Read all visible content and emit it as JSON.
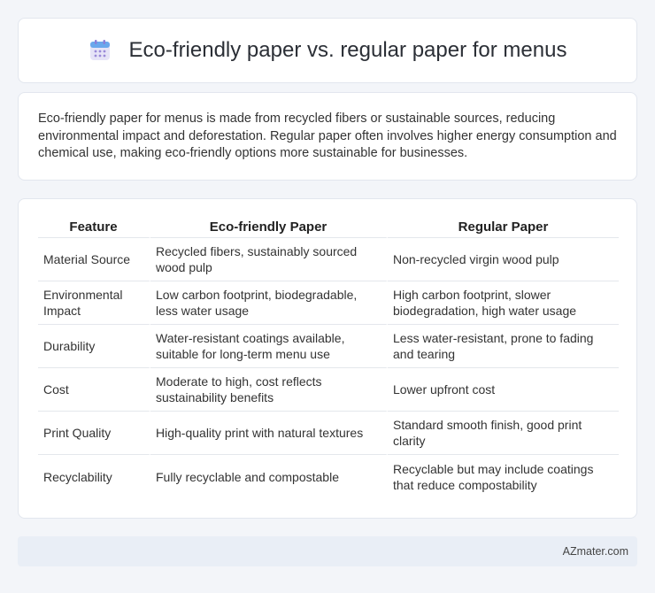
{
  "header": {
    "title": "Eco-friendly paper vs. regular paper for menus",
    "icon": "calendar-icon"
  },
  "summary": {
    "text": "Eco-friendly paper for menus is made from recycled fibers or sustainable sources, reducing environmental impact and deforestation. Regular paper often involves higher energy consumption and chemical use, making eco-friendly options more sustainable for businesses."
  },
  "table": {
    "headers": [
      "Feature",
      "Eco-friendly Paper",
      "Regular Paper"
    ],
    "rows": [
      [
        "Material Source",
        "Recycled fibers, sustainably sourced wood pulp",
        "Non-recycled virgin wood pulp"
      ],
      [
        "Environmental Impact",
        "Low carbon footprint, biodegradable, less water usage",
        "High carbon footprint, slower biodegradation, high water usage"
      ],
      [
        "Durability",
        "Water-resistant coatings available, suitable for long-term menu use",
        "Less water-resistant, prone to fading and tearing"
      ],
      [
        "Cost",
        "Moderate to high, cost reflects sustainability benefits",
        "Lower upfront cost"
      ],
      [
        "Print Quality",
        "High-quality print with natural textures",
        "Standard smooth finish, good print clarity"
      ],
      [
        "Recyclability",
        "Fully recyclable and compostable",
        "Recyclable but may include coatings that reduce compostability"
      ]
    ]
  },
  "footer": {
    "brand": "AZmater.com"
  }
}
